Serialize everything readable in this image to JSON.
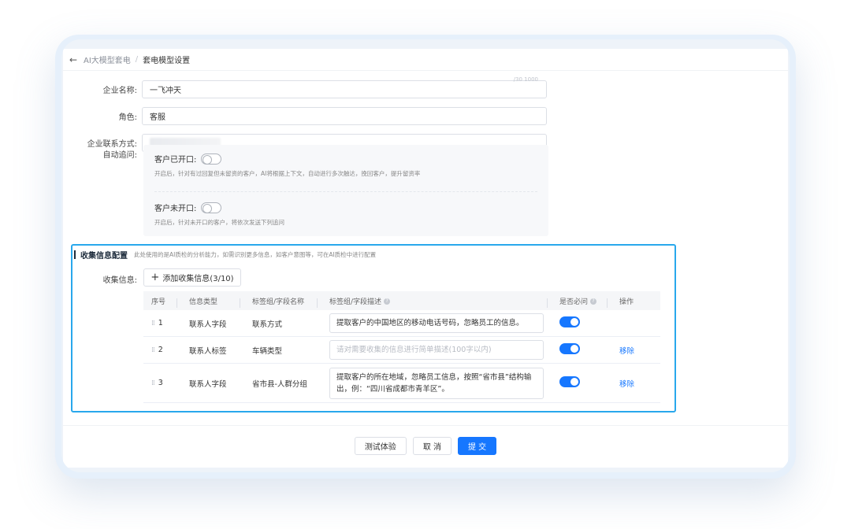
{
  "breadcrumb": {
    "back_icon": "arrow-left-icon",
    "parent": "AI大模型套电",
    "separator": "/",
    "current": "套电模型设置"
  },
  "form": {
    "company_name": {
      "label": "企业名称:",
      "value": "一飞冲天",
      "counter": "/30 1000"
    },
    "role": {
      "label": "角色:",
      "value": "客服"
    },
    "contact": {
      "label": "企业联系方式:",
      "value": ""
    },
    "auto_followup": {
      "label": "自动追问:",
      "items": [
        {
          "title": "客户已开口:",
          "enabled": false,
          "desc": "开启后，针对有过回复但未留资的客户，AI将根据上下文，自动进行多次触达，挽回客户，提升留资率"
        },
        {
          "title": "客户未开口:",
          "enabled": false,
          "desc": "开启后，针对未开口的客户，将依次发送下列追问"
        }
      ]
    }
  },
  "collect": {
    "title": "收集信息配置",
    "note": "此处使用的是AI质检的分析能力，如需识别更多信息，如客户意图等，可在AI质检中进行配置",
    "label": "收集信息:",
    "add_button": "添加收集信息(3/10)",
    "columns": {
      "no": "序号",
      "type": "信息类型",
      "name": "标签组/字段名称",
      "desc": "标签组/字段描述",
      "required": "是否必问",
      "op": "操作"
    },
    "rows": [
      {
        "no": "1",
        "type": "联系人字段",
        "name": "联系方式",
        "desc": "提取客户的中国地区的移动电话号码，忽略员工的信息。",
        "desc_placeholder": false,
        "required": true,
        "op": ""
      },
      {
        "no": "2",
        "type": "联系人标签",
        "name": "车辆类型",
        "desc": "请对需要收集的信息进行简单描述(100字以内)",
        "desc_placeholder": true,
        "required": true,
        "op": "移除"
      },
      {
        "no": "3",
        "type": "联系人字段",
        "name": "省市县-人群分组",
        "desc": "提取客户的所在地域，忽略员工信息，按照“省市县”结构输出，例：“四川省成都市青羊区”。",
        "desc_placeholder": false,
        "required": true,
        "op": "移除"
      }
    ]
  },
  "footer": {
    "test": "测试体验",
    "cancel": "取 消",
    "submit": "提 交"
  },
  "colors": {
    "accent": "#1677ff",
    "highlight_border": "#29a8ec"
  }
}
